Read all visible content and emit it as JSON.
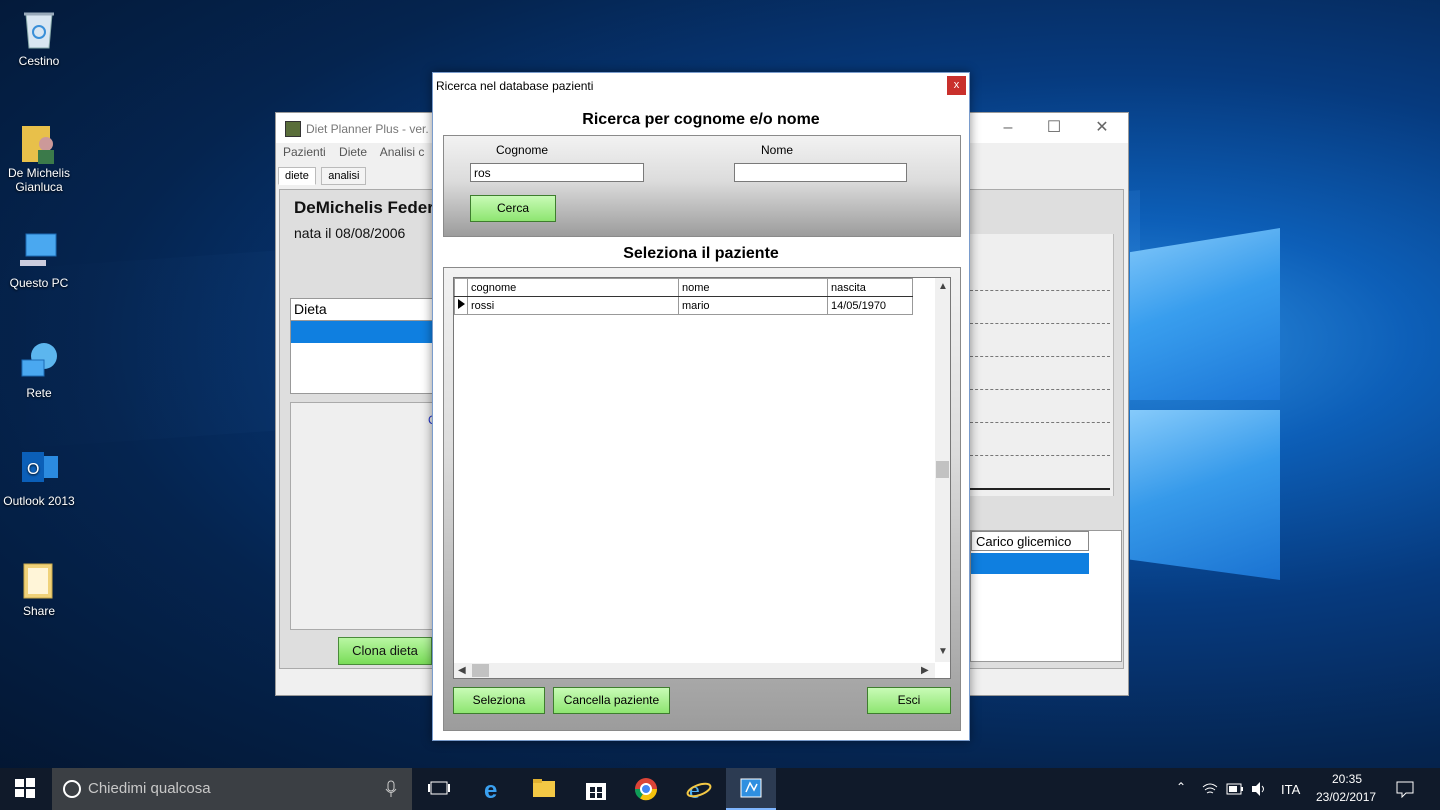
{
  "desktop": {
    "icons": [
      {
        "label": "Cestino",
        "icon": "recycle-bin-icon"
      },
      {
        "label": "De Michelis Gianluca",
        "icon": "user-folder-icon"
      },
      {
        "label": "Questo PC",
        "icon": "computer-icon"
      },
      {
        "label": "Rete",
        "icon": "network-icon"
      },
      {
        "label": "Outlook 2013",
        "icon": "outlook-icon"
      },
      {
        "label": "Share",
        "icon": "folder-icon"
      }
    ]
  },
  "background_window": {
    "title": "Diet Planner Plus - ver.",
    "menu": [
      "Pazienti",
      "Diete",
      "Analisi c"
    ],
    "tabs": [
      "diete",
      "analisi"
    ],
    "patient_name": "DeMichelis Federi",
    "patient_birth": "nata il 08/08/2006",
    "dieta_header": "Dieta",
    "clona_button": "Clona dieta",
    "carico_header": "Carico glicemico",
    "partial_link": "C"
  },
  "dialog": {
    "title": "Ricerca nel database pazienti",
    "close_label": "x",
    "search_heading": "Ricerca per cognome e/o nome",
    "cognome_label": "Cognome",
    "cognome_value": "ros",
    "nome_label": "Nome",
    "nome_value": "",
    "search_button": "Cerca",
    "select_heading": "Seleziona il paziente",
    "table": {
      "columns": [
        "cognome",
        "nome",
        "nascita"
      ],
      "rows": [
        {
          "cognome": "rossi",
          "nome": "mario",
          "nascita": "14/05/1970"
        }
      ]
    },
    "buttons": {
      "select": "Seleziona",
      "delete": "Cancella paziente",
      "exit": "Esci"
    }
  },
  "taskbar": {
    "search_placeholder": "Chiedimi qualcosa",
    "language": "ITA",
    "time": "20:35",
    "date": "23/02/2017"
  },
  "colors": {
    "accent_blue": "#0f7fe0",
    "button_green": "#8ee571",
    "close_red": "#c9302c",
    "taskbar": "#101a2a"
  }
}
